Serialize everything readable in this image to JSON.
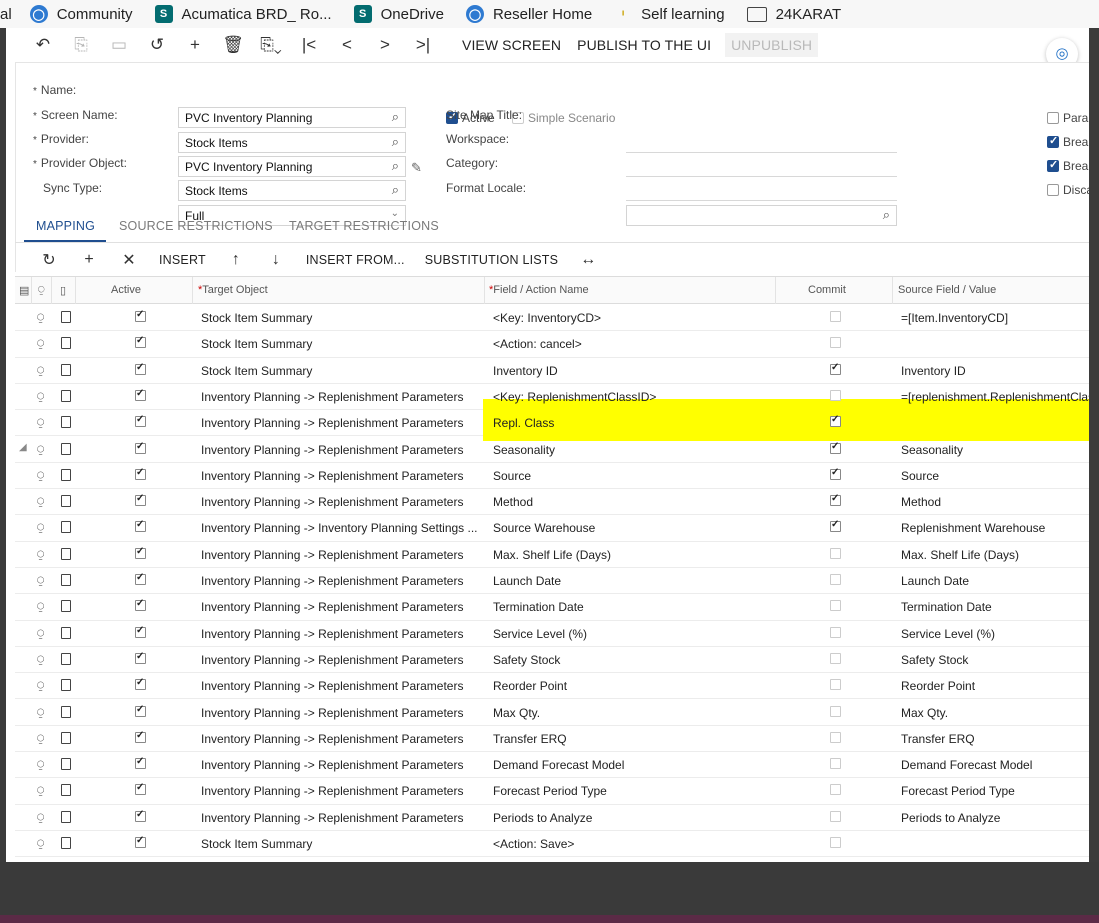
{
  "bookmarks": [
    {
      "label": "al",
      "icon": "none"
    },
    {
      "label": "Community",
      "icon": "acumatica-icon"
    },
    {
      "label": "Acumatica BRD_ Ro...",
      "icon": "sharepoint-icon"
    },
    {
      "label": "OneDrive",
      "icon": "sharepoint-icon"
    },
    {
      "label": "Reseller Home",
      "icon": "acumatica-icon"
    },
    {
      "label": "Self learning",
      "icon": "bulb-icon"
    },
    {
      "label": "24KARAT",
      "icon": "folder-icon"
    }
  ],
  "toolbar": {
    "view_screen": "VIEW SCREEN",
    "publish": "PUBLISH TO THE UI",
    "unpublish": "UNPUBLISH"
  },
  "form": {
    "name_label": "Name:",
    "name_value": "PVC Inventory Planning",
    "screen_name_label": "Screen Name:",
    "screen_name_value": "Stock Items",
    "provider_label": "Provider:",
    "provider_value": "PVC Inventory Planning",
    "provider_object_label": "Provider Object:",
    "provider_object_value": "Stock Items",
    "sync_type_label": "Sync Type:",
    "sync_type_value": "Full",
    "active_label": "Active",
    "simple_scenario_label": "Simple Scenario",
    "site_map_title_label": "Site Map Title:",
    "workspace_label": "Workspace:",
    "category_label": "Category:",
    "format_locale_label": "Format Locale:",
    "right_checks": [
      {
        "label": "Paral",
        "checked": false
      },
      {
        "label": "Break",
        "checked": true
      },
      {
        "label": "Break",
        "checked": true
      },
      {
        "label": "Disca",
        "checked": false
      }
    ]
  },
  "tabs": [
    "MAPPING",
    "SOURCE RESTRICTIONS",
    "TARGET RESTRICTIONS"
  ],
  "grid_toolbar": {
    "insert": "INSERT",
    "insert_from": "INSERT FROM...",
    "substitution_lists": "SUBSTITUTION LISTS"
  },
  "grid": {
    "headers": {
      "active": "Active",
      "target_object": "Target Object",
      "field_action": "Field / Action Name",
      "commit": "Commit",
      "source_field": "Source Field / Value"
    },
    "rows": [
      {
        "active": true,
        "target": "Stock Item Summary",
        "field": "<Key: InventoryCD>",
        "commit": false,
        "source": "=[Item.InventoryCD]"
      },
      {
        "active": true,
        "target": "Stock Item Summary",
        "field": "<Action: cancel>",
        "commit": false,
        "source": ""
      },
      {
        "active": true,
        "target": "Stock Item Summary",
        "field": "Inventory ID",
        "commit": true,
        "source": "Inventory ID"
      },
      {
        "active": true,
        "target": "Inventory Planning -> Replenishment Parameters",
        "field": "<Key: ReplenishmentClassID>",
        "commit": false,
        "source": "=[replenishment.ReplenishmentClas"
      },
      {
        "active": true,
        "target": "Inventory Planning -> Replenishment Parameters",
        "field": "Repl. Class",
        "commit": true,
        "source": "",
        "highlight": true
      },
      {
        "active": true,
        "target": "Inventory Planning -> Replenishment Parameters",
        "field": "Seasonality",
        "commit": true,
        "source": "Seasonality",
        "marker": true
      },
      {
        "active": true,
        "target": "Inventory Planning -> Replenishment Parameters",
        "field": "Source",
        "commit": true,
        "source": "Source"
      },
      {
        "active": true,
        "target": "Inventory Planning -> Replenishment Parameters",
        "field": "Method",
        "commit": true,
        "source": "Method"
      },
      {
        "active": true,
        "target": "Inventory Planning -> Inventory Planning Settings ...",
        "field": "Source Warehouse",
        "commit": true,
        "source": "Replenishment Warehouse"
      },
      {
        "active": true,
        "target": "Inventory Planning -> Replenishment Parameters",
        "field": "Max. Shelf Life (Days)",
        "commit": false,
        "source": "Max. Shelf Life (Days)"
      },
      {
        "active": true,
        "target": "Inventory Planning -> Replenishment Parameters",
        "field": "Launch Date",
        "commit": false,
        "source": "Launch Date"
      },
      {
        "active": true,
        "target": "Inventory Planning -> Replenishment Parameters",
        "field": "Termination Date",
        "commit": false,
        "source": "Termination Date"
      },
      {
        "active": true,
        "target": "Inventory Planning -> Replenishment Parameters",
        "field": "Service Level (%)",
        "commit": false,
        "source": "Service Level (%)"
      },
      {
        "active": true,
        "target": "Inventory Planning -> Replenishment Parameters",
        "field": "Safety Stock",
        "commit": false,
        "source": "Safety Stock"
      },
      {
        "active": true,
        "target": "Inventory Planning -> Replenishment Parameters",
        "field": "Reorder Point",
        "commit": false,
        "source": "Reorder Point"
      },
      {
        "active": true,
        "target": "Inventory Planning -> Replenishment Parameters",
        "field": "Max Qty.",
        "commit": false,
        "source": "Max Qty."
      },
      {
        "active": true,
        "target": "Inventory Planning -> Replenishment Parameters",
        "field": "Transfer ERQ",
        "commit": false,
        "source": "Transfer ERQ"
      },
      {
        "active": true,
        "target": "Inventory Planning -> Replenishment Parameters",
        "field": "Demand Forecast Model",
        "commit": false,
        "source": "Demand Forecast Model"
      },
      {
        "active": true,
        "target": "Inventory Planning -> Replenishment Parameters",
        "field": "Forecast Period Type",
        "commit": false,
        "source": "Forecast Period Type"
      },
      {
        "active": true,
        "target": "Inventory Planning -> Replenishment Parameters",
        "field": "Periods to Analyze",
        "commit": false,
        "source": "Periods to Analyze"
      },
      {
        "active": true,
        "target": "Stock Item Summary",
        "field": "<Action: Save>",
        "commit": false,
        "source": ""
      }
    ]
  },
  "colors": {
    "accent": "#1f4e8f",
    "highlight": "#ffff00"
  }
}
